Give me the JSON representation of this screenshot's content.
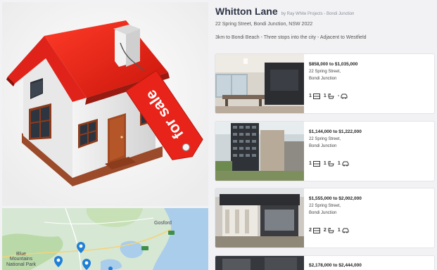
{
  "hero": {
    "sign_text": "for sale"
  },
  "map": {
    "labels": {
      "gosford": "Gosford",
      "blue_mountains": "Blue\nMountains\nNational Park"
    }
  },
  "project": {
    "title": "Whitton Lane",
    "byline": "by Ray White Projects - Bondi Junction",
    "address": "22 Spring Street, Bondi Junction, NSW 2022",
    "tagline": "3km to Bondi Beach  -  Three stops into the city  -  Adjacent to Westfield"
  },
  "listings": [
    {
      "price": "$858,000 to $1,035,000",
      "street": "22 Spring Street,",
      "suburb": "Bondi Junction",
      "beds": "1",
      "baths": "1",
      "cars": "-"
    },
    {
      "price": "$1,144,000 to $1,222,000",
      "street": "22 Spring Street,",
      "suburb": "Bondi Junction",
      "beds": "1",
      "baths": "1",
      "cars": "1"
    },
    {
      "price": "$1,555,000 to $2,002,000",
      "street": "22 Spring Street,",
      "suburb": "Bondi Junction",
      "beds": "2",
      "baths": "2",
      "cars": "1"
    },
    {
      "price": "$2,178,000 to $2,444,000",
      "street": "",
      "suburb": "",
      "beds": "",
      "baths": "",
      "cars": ""
    }
  ]
}
